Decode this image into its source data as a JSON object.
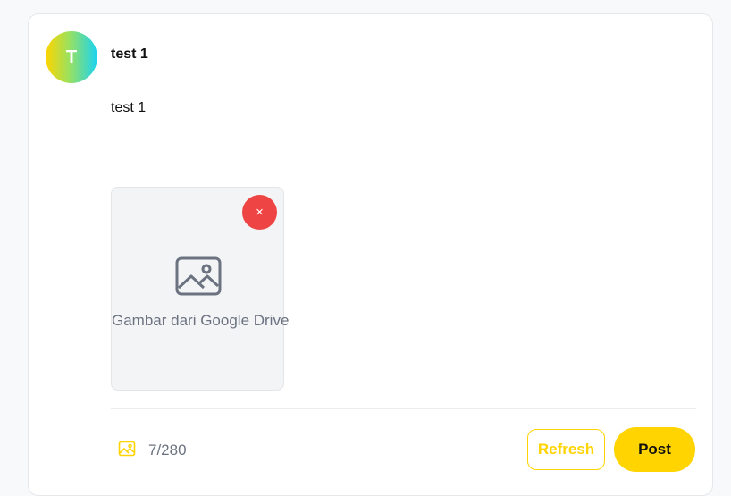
{
  "post": {
    "avatar_initial": "T",
    "username": "test 1",
    "content": "test 1"
  },
  "attachment": {
    "label": "Gambar dari Google Drive",
    "remove_label": "×",
    "icon": "image-icon"
  },
  "composer": {
    "media_icon": "image-icon",
    "char_count": "7/280",
    "refresh_label": "Refresh",
    "post_label": "Post"
  },
  "colors": {
    "accent": "#ffd400",
    "danger": "#ef4444",
    "muted_text": "#6b7280"
  }
}
